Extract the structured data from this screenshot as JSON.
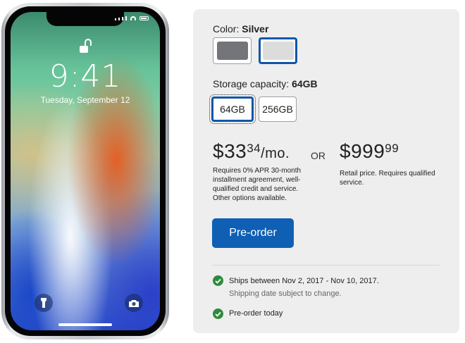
{
  "phone": {
    "clock": "9:41",
    "date": "Tuesday, September 12"
  },
  "color": {
    "label": "Color:",
    "selected": "Silver",
    "options": [
      {
        "name": "space-gray",
        "hex": "#737578"
      },
      {
        "name": "silver",
        "hex": "#dcdcdc"
      }
    ]
  },
  "storage": {
    "label": "Storage capacity:",
    "selected": "64GB",
    "options": [
      "64GB",
      "256GB"
    ]
  },
  "pricing": {
    "monthly_dollars": "$33",
    "monthly_cents": "34",
    "monthly_unit": "/mo.",
    "monthly_note": "Requires 0% APR 30-month installment agreement, well-qualified credit and service. Other options available.",
    "or": "OR",
    "retail_dollars": "$999",
    "retail_cents": "99",
    "retail_note": "Retail price. Requires qualified service."
  },
  "actions": {
    "preorder_label": "Pre-order"
  },
  "shipping": {
    "ships_text": "Ships between  Nov 2, 2017 - Nov 10, 2017.",
    "ships_sub": "Shipping date subject to change.",
    "preorder_today": "Pre-order today"
  },
  "colors": {
    "accent": "#0f5fb4",
    "selected_border": "#0f57a8",
    "check": "#2e8b3c",
    "panel_bg": "#eeeeee"
  }
}
